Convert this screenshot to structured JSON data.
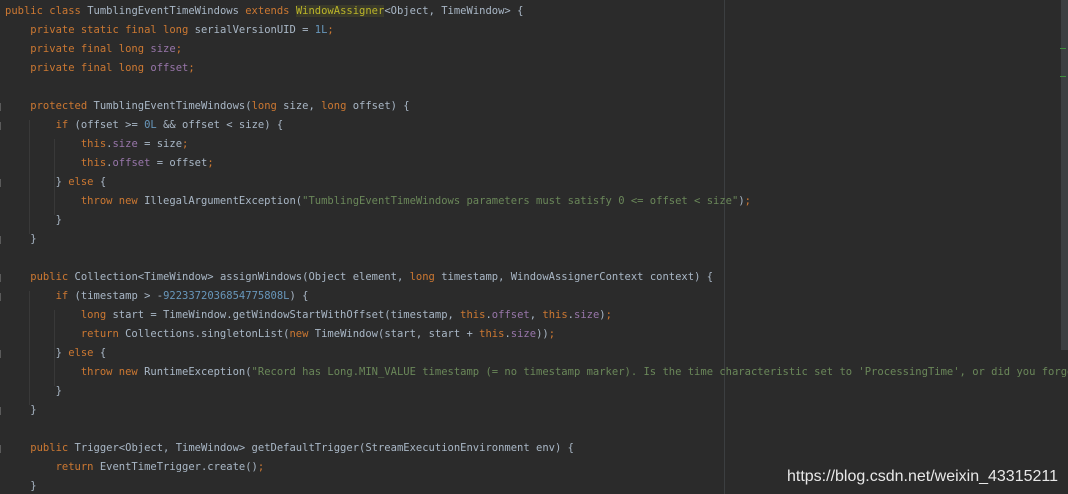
{
  "watermark": "https://blog.csdn.net/weixin_43315211",
  "code": [
    {
      "name": "line-1",
      "tokens": [
        [
          "kw",
          "public class "
        ],
        [
          "cls",
          "TumblingEventTimeWindows "
        ],
        [
          "kw",
          "extends "
        ],
        [
          "sel",
          "WindowAssigner"
        ],
        [
          "cls",
          "<Object, TimeWindow> {"
        ]
      ]
    },
    {
      "name": "line-2",
      "tokens": [
        [
          "kw",
          "    private static final long "
        ],
        [
          "cls",
          "serialVersionUID = "
        ],
        [
          "num",
          "1L"
        ],
        [
          "kw",
          ";"
        ]
      ]
    },
    {
      "name": "line-3",
      "tokens": [
        [
          "kw",
          "    private final long "
        ],
        [
          "fld",
          "size"
        ],
        [
          "kw",
          ";"
        ]
      ]
    },
    {
      "name": "line-4",
      "tokens": [
        [
          "kw",
          "    private final long "
        ],
        [
          "fld",
          "offset"
        ],
        [
          "kw",
          ";"
        ]
      ]
    },
    {
      "name": "line-5",
      "tokens": []
    },
    {
      "name": "line-6",
      "tokens": [
        [
          "kw",
          "    protected "
        ],
        [
          "cls",
          "TumblingEventTimeWindows("
        ],
        [
          "kw",
          "long "
        ],
        [
          "cls",
          "size, "
        ],
        [
          "kw",
          "long "
        ],
        [
          "cls",
          "offset) {"
        ]
      ]
    },
    {
      "name": "line-7",
      "tokens": [
        [
          "kw",
          "        if "
        ],
        [
          "cls",
          "(offset >= "
        ],
        [
          "num",
          "0L "
        ],
        [
          "cls",
          "&& offset < size) {"
        ]
      ]
    },
    {
      "name": "line-8",
      "tokens": [
        [
          "kw",
          "            this"
        ],
        [
          "cls",
          "."
        ],
        [
          "fld",
          "size "
        ],
        [
          "cls",
          "= size"
        ],
        [
          "kw",
          ";"
        ]
      ]
    },
    {
      "name": "line-9",
      "tokens": [
        [
          "kw",
          "            this"
        ],
        [
          "cls",
          "."
        ],
        [
          "fld",
          "offset "
        ],
        [
          "cls",
          "= offset"
        ],
        [
          "kw",
          ";"
        ]
      ]
    },
    {
      "name": "line-10",
      "tokens": [
        [
          "cls",
          "        } "
        ],
        [
          "kw",
          "else "
        ],
        [
          "cls",
          "{"
        ]
      ]
    },
    {
      "name": "line-11",
      "tokens": [
        [
          "kw",
          "            throw new "
        ],
        [
          "cls",
          "IllegalArgumentException("
        ],
        [
          "str",
          "\"TumblingEventTimeWindows parameters must satisfy 0 <= offset < size\""
        ],
        [
          "cls",
          ")"
        ],
        [
          "kw",
          ";"
        ]
      ]
    },
    {
      "name": "line-12",
      "tokens": [
        [
          "cls",
          "        }"
        ]
      ]
    },
    {
      "name": "line-13",
      "tokens": [
        [
          "cls",
          "    }"
        ]
      ]
    },
    {
      "name": "line-14",
      "tokens": []
    },
    {
      "name": "line-15",
      "tokens": [
        [
          "kw",
          "    public "
        ],
        [
          "cls",
          "Collection<TimeWindow> assignWindows(Object element, "
        ],
        [
          "kw",
          "long "
        ],
        [
          "cls",
          "timestamp, WindowAssignerContext context) {"
        ]
      ]
    },
    {
      "name": "line-16",
      "tokens": [
        [
          "kw",
          "        if "
        ],
        [
          "cls",
          "(timestamp > -"
        ],
        [
          "num",
          "9223372036854775808L"
        ],
        [
          "cls",
          ") {"
        ]
      ]
    },
    {
      "name": "line-17",
      "tokens": [
        [
          "kw",
          "            long "
        ],
        [
          "cls",
          "start = TimeWindow.getWindowStartWithOffset(timestamp, "
        ],
        [
          "kw",
          "this"
        ],
        [
          "cls",
          "."
        ],
        [
          "fld",
          "offset"
        ],
        [
          "cls",
          ", "
        ],
        [
          "kw",
          "this"
        ],
        [
          "cls",
          "."
        ],
        [
          "fld",
          "size"
        ],
        [
          "cls",
          ")"
        ],
        [
          "kw",
          ";"
        ]
      ]
    },
    {
      "name": "line-18",
      "tokens": [
        [
          "kw",
          "            return "
        ],
        [
          "cls",
          "Collections.singletonList("
        ],
        [
          "kw",
          "new "
        ],
        [
          "cls",
          "TimeWindow(start, start + "
        ],
        [
          "kw",
          "this"
        ],
        [
          "cls",
          "."
        ],
        [
          "fld",
          "size"
        ],
        [
          "cls",
          "))"
        ],
        [
          "kw",
          ";"
        ]
      ]
    },
    {
      "name": "line-19",
      "tokens": [
        [
          "cls",
          "        } "
        ],
        [
          "kw",
          "else "
        ],
        [
          "cls",
          "{"
        ]
      ]
    },
    {
      "name": "line-20",
      "tokens": [
        [
          "kw",
          "            throw new "
        ],
        [
          "cls",
          "RuntimeException("
        ],
        [
          "str",
          "\"Record has Long.MIN_VALUE timestamp (= no timestamp marker). Is the time characteristic set to 'ProcessingTime', or did you forget to call"
        ]
      ]
    },
    {
      "name": "line-21",
      "tokens": [
        [
          "cls",
          "        }"
        ]
      ]
    },
    {
      "name": "line-22",
      "tokens": [
        [
          "cls",
          "    }"
        ]
      ]
    },
    {
      "name": "line-23",
      "tokens": []
    },
    {
      "name": "line-24",
      "tokens": [
        [
          "kw",
          "    public "
        ],
        [
          "cls",
          "Trigger<Object, TimeWindow> getDefaultTrigger(StreamExecutionEnvironment env) {"
        ]
      ]
    },
    {
      "name": "line-25",
      "tokens": [
        [
          "kw",
          "        return "
        ],
        [
          "cls",
          "EventTimeTrigger."
        ],
        [
          "cls",
          "create()"
        ],
        [
          "kw",
          ";"
        ]
      ]
    },
    {
      "name": "line-26",
      "tokens": [
        [
          "cls",
          "    }"
        ]
      ]
    }
  ]
}
